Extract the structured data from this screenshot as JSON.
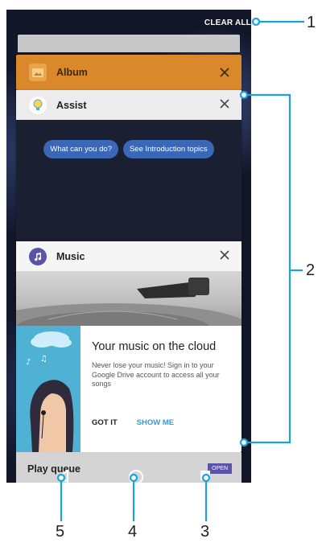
{
  "header": {
    "clear_all": "CLEAR ALL"
  },
  "cards": {
    "album": {
      "title": "Album",
      "accent": "#d9892b"
    },
    "assist": {
      "title": "Assist",
      "chips": [
        "What can you do?",
        "See Introduction topics"
      ],
      "accent": "#3a67b6"
    },
    "music": {
      "title": "Music",
      "promo_title": "Your music on the cloud",
      "promo_body": "Never lose your music! Sign in to your Google Drive account to access all your songs",
      "action_got_it": "GOT IT",
      "action_show_me": "SHOW ME",
      "accent": "#5a54a8"
    },
    "partial": {
      "text": "Play queue",
      "open_label": "OPEN"
    }
  },
  "icons": {
    "album": "album-icon",
    "assist": "lightbulb-icon",
    "music": "music-note-icon",
    "close": "close-icon",
    "back": "back-triangle-icon",
    "home": "home-circle-icon",
    "recent": "recent-apps-square-icon"
  },
  "callouts": {
    "one": "1",
    "two": "2",
    "three": "3",
    "four": "4",
    "five": "5"
  },
  "colors": {
    "callout_line": "#1da1dc"
  }
}
